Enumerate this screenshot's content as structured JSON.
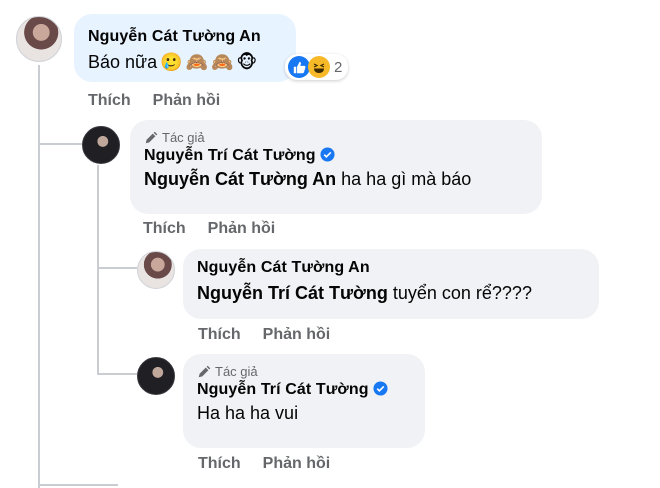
{
  "comments": [
    {
      "author": "Nguyễn Cát Tường An",
      "text": "Báo nữa",
      "emojis": [
        "🥲",
        "🙈",
        "🙈",
        "🐵"
      ],
      "reactions": {
        "icons": [
          "like-icon",
          "haha-icon"
        ],
        "count": "2"
      },
      "actions": {
        "like": "Thích",
        "reply": "Phản hồi"
      }
    },
    {
      "author_tag": "Tác giả",
      "author": "Nguyễn Trí Cát Tường",
      "mention": "Nguyễn Cát Tường An",
      "text": " ha ha gì mà báo",
      "actions": {
        "like": "Thích",
        "reply": "Phản hồi"
      }
    },
    {
      "author": "Nguyễn Cát Tường An",
      "mention": "Nguyễn Trí Cát Tường",
      "text": " tuyển con rể????",
      "actions": {
        "like": "Thích",
        "reply": "Phản hồi"
      }
    },
    {
      "author_tag": "Tác giả",
      "author": "Nguyễn Trí Cát Tường",
      "text": "Ha ha ha vui",
      "actions": {
        "like": "Thích",
        "reply": "Phản hồi"
      }
    }
  ],
  "colors": {
    "like_blue": "#1877f2",
    "haha_yellow": "#f7b928",
    "secondary_text": "#65676b",
    "bubble_bg": "#f0f2f5"
  }
}
